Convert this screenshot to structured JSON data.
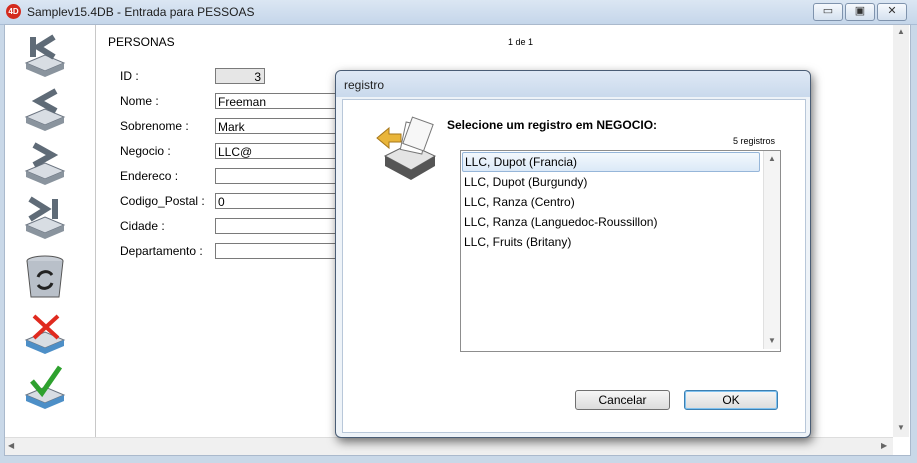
{
  "window": {
    "logo": "4D",
    "title": "Samplev15.4DB - Entrada para PESSOAS",
    "minimize_glyph": "▭",
    "maximize_glyph": "▣",
    "close_glyph": "✕"
  },
  "form": {
    "title": "PERSONAS",
    "record_indicator": "1 de 1",
    "fields": [
      {
        "label": "ID :",
        "value": "3"
      },
      {
        "label": "Nome :",
        "value": "Freeman"
      },
      {
        "label": "Sobrenome :",
        "value": "Mark"
      },
      {
        "label": "Negocio :",
        "value": "LLC@"
      },
      {
        "label": "Endereco :",
        "value": ""
      },
      {
        "label": "Codigo_Postal :",
        "value": "0"
      },
      {
        "label": "Cidade :",
        "value": ""
      },
      {
        "label": "Departamento :",
        "value": ""
      }
    ]
  },
  "toolbar": {
    "tools": [
      "first-record-icon",
      "previous-record-icon",
      "next-record-icon",
      "last-record-icon",
      "trash-recycle-icon",
      "cancel-icon",
      "accept-icon"
    ]
  },
  "dialog": {
    "title": "registro",
    "prompt": "Selecione um registro em  NEGOCIO:",
    "count": "5 registros",
    "records": [
      "LLC, Dupot (Francia)",
      "LLC, Dupot (Burgundy)",
      "LLC, Ranza (Centro)",
      "LLC, Ranza (Languedoc-Roussillon)",
      "LLC, Fruits (Britany)"
    ],
    "selected_index": 0,
    "cancel_label": "Cancelar",
    "ok_label": "OK"
  },
  "colors": {
    "accent": "#3c7fb1",
    "selection": "#dbe9f7",
    "logo_red": "#d42b1e"
  }
}
